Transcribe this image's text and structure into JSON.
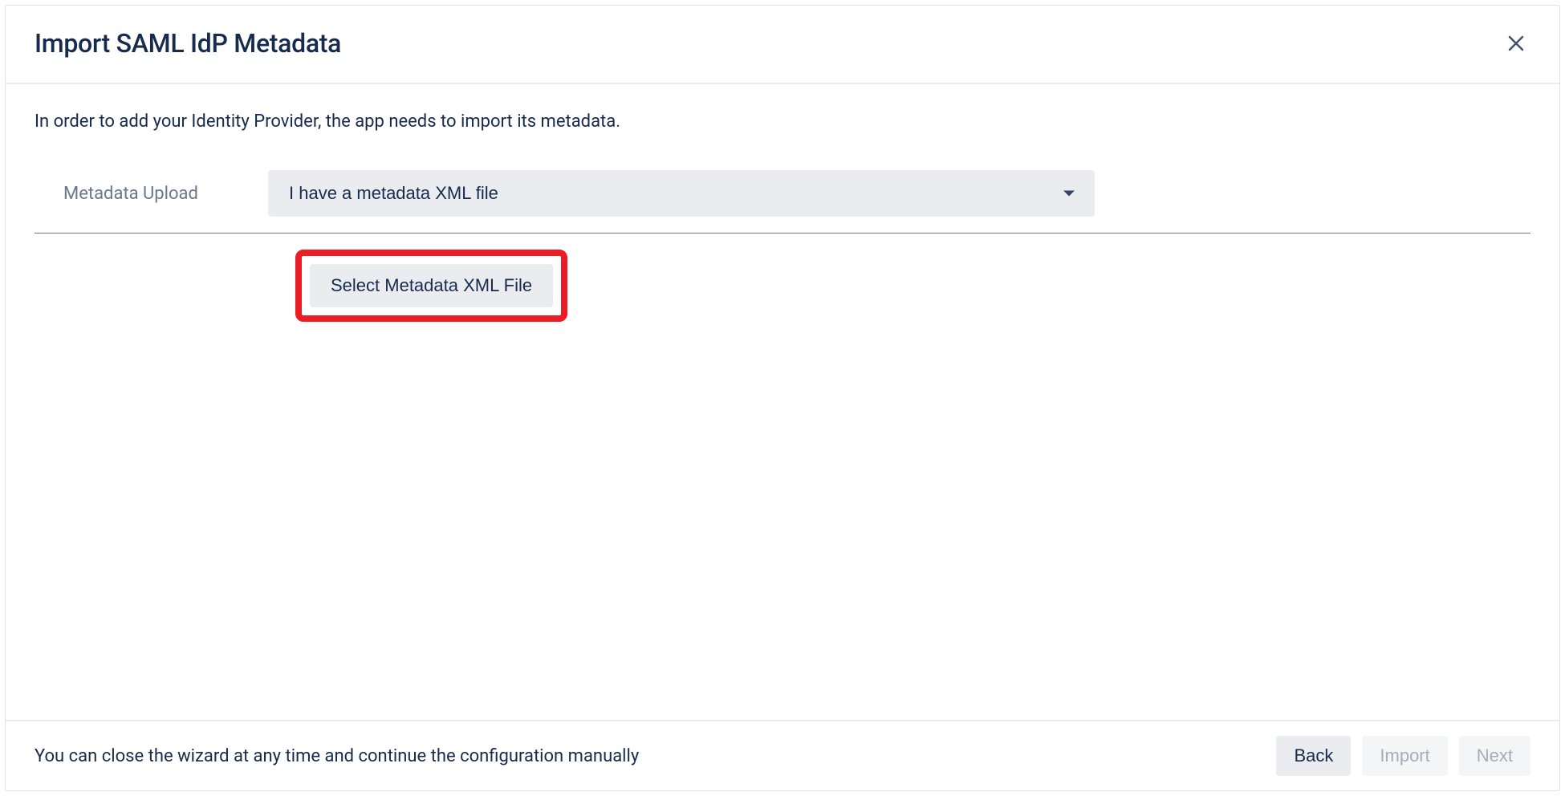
{
  "dialog": {
    "title": "Import SAML IdP Metadata",
    "description": "In order to add your Identity Provider, the app needs to import its metadata."
  },
  "form": {
    "upload_label": "Metadata Upload",
    "select_value": "I have a metadata XML file",
    "file_button_label": "Select Metadata XML File"
  },
  "footer": {
    "hint": "You can close the wizard at any time and continue the configuration manually",
    "back_label": "Back",
    "import_label": "Import",
    "next_label": "Next"
  }
}
